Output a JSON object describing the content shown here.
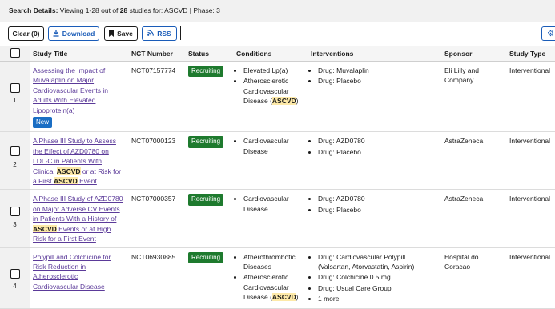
{
  "search": {
    "label": "Search Details:",
    "prefix": "Viewing 1-28 out of",
    "count": "28",
    "suffix": "studies for: ASCVD | Phase: 3"
  },
  "toolbar": {
    "clear": "Clear (0)",
    "download": "Download",
    "save": "Save",
    "rss": "RSS"
  },
  "columns": [
    "Study Title",
    "NCT Number",
    "Status",
    "Conditions",
    "Interventions",
    "Sponsor",
    "Study Type"
  ],
  "rows": [
    {
      "num": "1",
      "title": "Assessing the Impact of Muvalaplin on Major Cardiovascular Events in Adults With Elevated Lipoprotein(a)",
      "badge": "New",
      "nct": "NCT07157774",
      "status": "Recruiting",
      "conditions": [
        "Elevated Lp(a)",
        "Atherosclerotic Cardiovascular Disease (ASCVD)"
      ],
      "interventions": [
        "Drug: Muvalaplin",
        "Drug: Placebo"
      ],
      "sponsor": "Eli Lilly and Company",
      "type": "Interventional"
    },
    {
      "num": "2",
      "title": "A Phase III Study to Assess the Effect of AZD0780 on LDL-C in Patients With Clinical ASCVD or at Risk for a First ASCVD Event",
      "nct": "NCT07000123",
      "status": "Recruiting",
      "conditions": [
        "Cardiovascular Disease"
      ],
      "interventions": [
        "Drug: AZD0780",
        "Drug: Placebo"
      ],
      "sponsor": "AstraZeneca",
      "type": "Interventional"
    },
    {
      "num": "3",
      "title": "A Phase III Study of AZD0780 on Major Adverse CV Events in Patients With a History of ASCVD Events or at High Risk for a First Event",
      "nct": "NCT07000357",
      "status": "Recruiting",
      "conditions": [
        "Cardiovascular Disease"
      ],
      "interventions": [
        "Drug: AZD0780",
        "Drug: Placebo"
      ],
      "sponsor": "AstraZeneca",
      "type": "Interventional"
    },
    {
      "num": "4",
      "title": "Polypill and Colchicine for Risk Reduction in Atherosclerotic Cardiovascular Disease",
      "nct": "NCT06930885",
      "status": "Recruiting",
      "conditions": [
        "Atherothrombotic Diseases",
        "Atherosclerotic Cardiovascular Disease (ASCVD)"
      ],
      "interventions": [
        "Drug: Cardiovascular Polypill (Valsartan, Atorvastatin, Aspirin)",
        "Drug: Colchicine 0.5 mg",
        "Drug: Usual Care Group",
        "1 more"
      ],
      "sponsor": "Hospital do Coracao",
      "type": "Interventional"
    }
  ],
  "highlight_term": "ASCVD",
  "colors": {
    "status_green": "#1e7a2e",
    "link_purple": "#5b3a99",
    "badge_blue": "#1a6ec4",
    "accent_blue": "#1a5cb8"
  }
}
